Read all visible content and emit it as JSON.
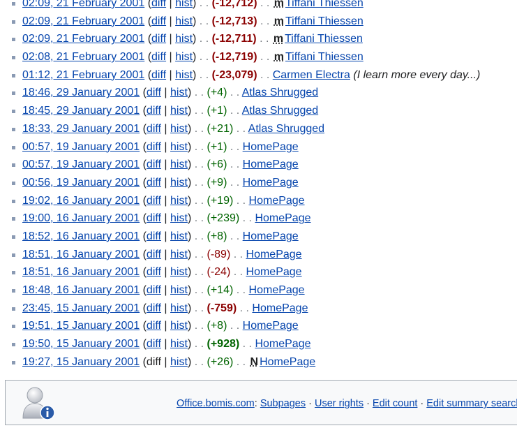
{
  "contributions": [
    {
      "timestamp": "02:09, 21 February 2001",
      "diff": "diff",
      "hist": "hist",
      "diff_link": true,
      "size": "(-12,712)",
      "size_class": "minus-big",
      "flag": "m",
      "page": "Tiffani Thiessen",
      "summary": ""
    },
    {
      "timestamp": "02:09, 21 February 2001",
      "diff": "diff",
      "hist": "hist",
      "diff_link": true,
      "size": "(-12,713)",
      "size_class": "minus-big",
      "flag": "m",
      "page": "Tiffani Thiessen",
      "summary": ""
    },
    {
      "timestamp": "02:09, 21 February 2001",
      "diff": "diff",
      "hist": "hist",
      "diff_link": true,
      "size": "(-12,711)",
      "size_class": "minus-big",
      "flag": "m",
      "page": "Tiffani Thiessen",
      "summary": ""
    },
    {
      "timestamp": "02:08, 21 February 2001",
      "diff": "diff",
      "hist": "hist",
      "diff_link": true,
      "size": "(-12,719)",
      "size_class": "minus-big",
      "flag": "m",
      "page": "Tiffani Thiessen",
      "summary": ""
    },
    {
      "timestamp": "01:12, 21 February 2001",
      "diff": "diff",
      "hist": "hist",
      "diff_link": true,
      "size": "(-23,079)",
      "size_class": "minus-big",
      "flag": "",
      "page": "Carmen Electra",
      "summary": "(I learn more every day...)"
    },
    {
      "timestamp": "18:46, 29 January 2001",
      "diff": "diff",
      "hist": "hist",
      "diff_link": true,
      "size": "(+4)",
      "size_class": "plus",
      "flag": "",
      "page": "Atlas Shrugged",
      "summary": ""
    },
    {
      "timestamp": "18:45, 29 January 2001",
      "diff": "diff",
      "hist": "hist",
      "diff_link": true,
      "size": "(+1)",
      "size_class": "plus",
      "flag": "",
      "page": "Atlas Shrugged",
      "summary": ""
    },
    {
      "timestamp": "18:33, 29 January 2001",
      "diff": "diff",
      "hist": "hist",
      "diff_link": true,
      "size": "(+21)",
      "size_class": "plus",
      "flag": "",
      "page": "Atlas Shrugged",
      "summary": ""
    },
    {
      "timestamp": "00:57, 19 January 2001",
      "diff": "diff",
      "hist": "hist",
      "diff_link": true,
      "size": "(+1)",
      "size_class": "plus",
      "flag": "",
      "page": "HomePage",
      "summary": ""
    },
    {
      "timestamp": "00:57, 19 January 2001",
      "diff": "diff",
      "hist": "hist",
      "diff_link": true,
      "size": "(+6)",
      "size_class": "plus",
      "flag": "",
      "page": "HomePage",
      "summary": ""
    },
    {
      "timestamp": "00:56, 19 January 2001",
      "diff": "diff",
      "hist": "hist",
      "diff_link": true,
      "size": "(+9)",
      "size_class": "plus",
      "flag": "",
      "page": "HomePage",
      "summary": ""
    },
    {
      "timestamp": "19:02, 16 January 2001",
      "diff": "diff",
      "hist": "hist",
      "diff_link": true,
      "size": "(+19)",
      "size_class": "plus",
      "flag": "",
      "page": "HomePage",
      "summary": ""
    },
    {
      "timestamp": "19:00, 16 January 2001",
      "diff": "diff",
      "hist": "hist",
      "diff_link": true,
      "size": "(+239)",
      "size_class": "plus",
      "flag": "",
      "page": "HomePage",
      "summary": ""
    },
    {
      "timestamp": "18:52, 16 January 2001",
      "diff": "diff",
      "hist": "hist",
      "diff_link": true,
      "size": "(+8)",
      "size_class": "plus",
      "flag": "",
      "page": "HomePage",
      "summary": ""
    },
    {
      "timestamp": "18:51, 16 January 2001",
      "diff": "diff",
      "hist": "hist",
      "diff_link": true,
      "size": "(-89)",
      "size_class": "minus",
      "flag": "",
      "page": "HomePage",
      "summary": ""
    },
    {
      "timestamp": "18:51, 16 January 2001",
      "diff": "diff",
      "hist": "hist",
      "diff_link": true,
      "size": "(-24)",
      "size_class": "minus",
      "flag": "",
      "page": "HomePage",
      "summary": ""
    },
    {
      "timestamp": "18:48, 16 January 2001",
      "diff": "diff",
      "hist": "hist",
      "diff_link": true,
      "size": "(+14)",
      "size_class": "plus",
      "flag": "",
      "page": "HomePage",
      "summary": ""
    },
    {
      "timestamp": "23:45, 15 January 2001",
      "diff": "diff",
      "hist": "hist",
      "diff_link": true,
      "size": "(-759)",
      "size_class": "minus-big",
      "flag": "",
      "page": "HomePage",
      "summary": ""
    },
    {
      "timestamp": "19:51, 15 January 2001",
      "diff": "diff",
      "hist": "hist",
      "diff_link": true,
      "size": "(+8)",
      "size_class": "plus",
      "flag": "",
      "page": "HomePage",
      "summary": ""
    },
    {
      "timestamp": "19:50, 15 January 2001",
      "diff": "diff",
      "hist": "hist",
      "diff_link": true,
      "size": "(+928)",
      "size_class": "plus-big",
      "flag": "",
      "page": "HomePage",
      "summary": ""
    },
    {
      "timestamp": "19:27, 15 January 2001",
      "diff": "diff",
      "hist": "hist",
      "diff_link": false,
      "size": "(+26)",
      "size_class": "plus",
      "flag": "N",
      "page": "HomePage",
      "summary": ""
    }
  ],
  "separators": {
    "open": "(",
    "bar": " | ",
    "close": ")",
    "dots": " . . "
  },
  "footer": {
    "icon": "user-info-icon",
    "user_link": "Office.bomis.com",
    "colon": ":",
    "links": [
      "Subpages",
      "User rights",
      "Edit count",
      "Edit summary search"
    ],
    "dot": "·"
  },
  "colors": {
    "link": "#0645ad",
    "negative": "#8b0000",
    "positive": "#006400",
    "footer_bg": "#f8f9fa",
    "footer_border": "#a2a9b1"
  }
}
